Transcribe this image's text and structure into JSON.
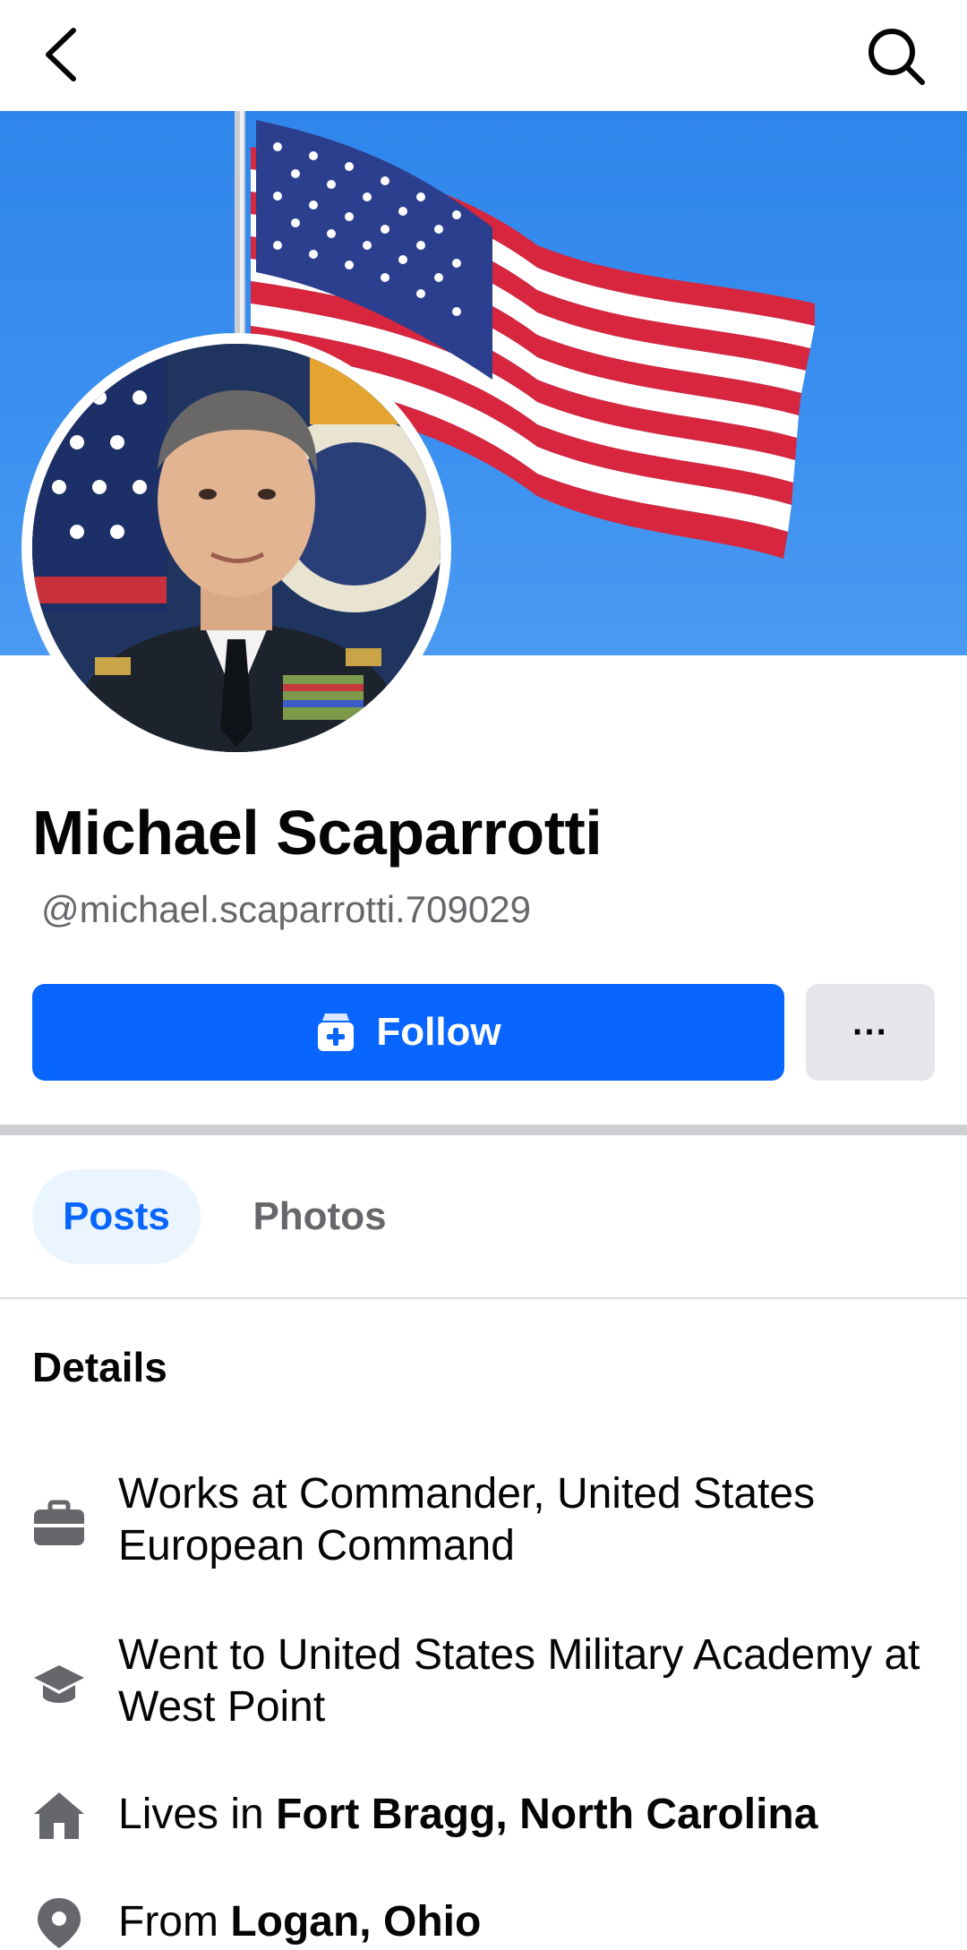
{
  "header": {
    "back_icon": "back-arrow-icon",
    "search_icon": "search-icon"
  },
  "profile": {
    "name": "Michael Scaparrotti",
    "handle": "@michael.scaparrotti.709029"
  },
  "actions": {
    "follow_label": "Follow",
    "follow_icon": "follow-user-plus-icon",
    "more_label": "···"
  },
  "tabs": [
    {
      "label": "Posts",
      "active": true
    },
    {
      "label": "Photos",
      "active": false
    }
  ],
  "details": {
    "title": "Details",
    "items": [
      {
        "icon": "briefcase-icon",
        "text": "Works at Commander, United States European Command"
      },
      {
        "icon": "graduation-cap-icon",
        "text": "Went to United States Military Academy at West Point"
      },
      {
        "icon": "home-icon",
        "prefix": "Lives in ",
        "bold": "Fort Bragg, North Carolina"
      },
      {
        "icon": "location-pin-icon",
        "prefix": "From ",
        "bold": "Logan, Ohio"
      }
    ]
  },
  "colors": {
    "accent": "#0866ff",
    "accent_soft": "#ebf5ff",
    "secondary_text": "#65676b",
    "cover_sky": "#3a8ff0"
  }
}
